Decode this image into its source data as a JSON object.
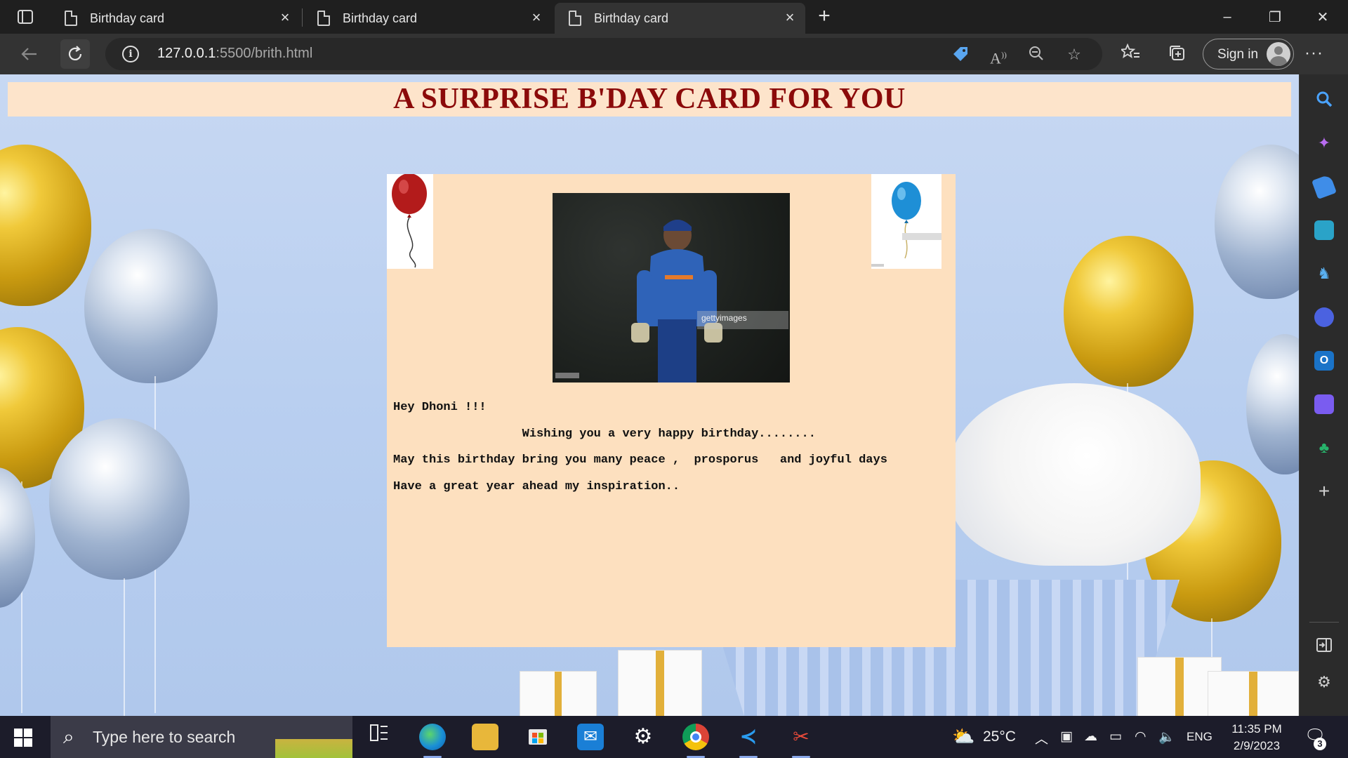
{
  "browser": {
    "tabs": [
      {
        "label": "Birthday card",
        "active": false
      },
      {
        "label": "Birthday card",
        "active": false
      },
      {
        "label": "Birthday card",
        "active": true
      }
    ],
    "new_tab_symbol": "+",
    "window_controls": {
      "minimize": "–",
      "restore": "❐",
      "close": "✕"
    },
    "url_host": "127.0.0.1",
    "url_rest": ":5500/brith.html",
    "sign_in_label": "Sign in",
    "more_symbol": "···"
  },
  "page": {
    "banner_title": "A SURPRISE B'DAY CARD FOR YOU",
    "banner_bg": "#fde4cb",
    "banner_color": "#8b0a0a",
    "card_bg": "#fde0bf",
    "photo_watermark": "gettyimages",
    "lines": [
      "Hey Dhoni !!!",
      "                  Wishing you a very happy birthday........",
      "May this birthday bring you many peace ,  prosporus   and joyful days",
      "Have a great year ahead my inspiration.."
    ]
  },
  "sidebar": {
    "icons": [
      "search-icon",
      "copilot-icon",
      "shopping-icon",
      "tools-icon",
      "games-icon",
      "office-icon",
      "outlook-icon",
      "designer-icon",
      "tree-icon",
      "add-icon",
      "split-screen-icon",
      "settings-icon"
    ]
  },
  "taskbar": {
    "search_placeholder": "Type here to search",
    "weather": "25°C",
    "language": "ENG",
    "time": "11:35 PM",
    "date": "2/9/2023",
    "notification_count": "3"
  }
}
